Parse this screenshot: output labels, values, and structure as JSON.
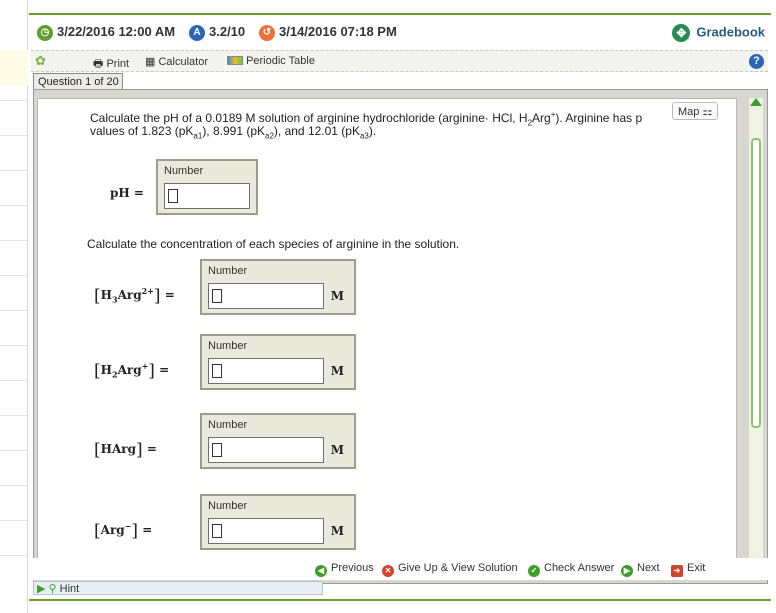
{
  "topbar": {
    "date1": "3/22/2016 12:00 AM",
    "score": "3.2/10",
    "date2": "3/14/2016 07:18 PM",
    "gradebook": "Gradebook"
  },
  "toolbar": {
    "print": "Print",
    "calculator": "Calculator",
    "periodic_table": "Periodic Table"
  },
  "question_tab": "Question 1 of 20",
  "map_label": "Map",
  "question": {
    "intro_line1_a": "Calculate the pH of a 0.0189 M solution of arginine hydrochloride (arginine",
    "intro_line1_b": "HCl, H",
    "intro_line1_c": "Arg",
    "intro_line1_d": "). Arginine has p",
    "intro_line2": "values of 1.823 (pK",
    "intro_line2_b": "), 8.991 (pK",
    "intro_line2_c": "), and 12.01 (pK",
    "intro_line2_d": ").",
    "sub_a1": "a1",
    "sub_a2": "a2",
    "sub_a3": "a3",
    "sub_2": "2",
    "sup_plus": "+",
    "species_prompt": "Calculate the concentration of each species of arginine in the solution."
  },
  "fields": {
    "number_label": "Number",
    "unit": "M",
    "ph_label": "pH ="
  },
  "species": [
    {
      "name": "H3Arg2+"
    },
    {
      "name": "H2Arg+"
    },
    {
      "name": "HArg"
    },
    {
      "name": "Arg-"
    }
  ],
  "bottom": {
    "previous": "Previous",
    "give_up": "Give Up & View Solution",
    "check": "Check Answer",
    "next": "Next",
    "exit": "Exit",
    "hint": "Hint"
  },
  "colors": {
    "accent_green": "#6aa12c",
    "gradebook_blue": "#2a5c7a",
    "next_green": "#3d9e2a"
  }
}
